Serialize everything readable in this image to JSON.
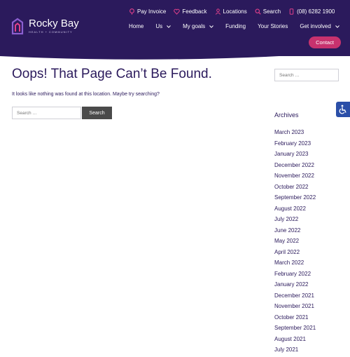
{
  "header": {
    "logo": {
      "title": "Rocky Bay",
      "subtitle": "HEALTH + COMMUNITY"
    },
    "utility": [
      {
        "label": "Pay Invoice",
        "icon": "dollar-pin-icon"
      },
      {
        "label": "Feedback",
        "icon": "heart-icon"
      },
      {
        "label": "Locations",
        "icon": "people-icon"
      },
      {
        "label": "Search",
        "icon": "search-icon"
      },
      {
        "label": "(08) 6282 1900",
        "icon": "phone-icon"
      }
    ],
    "nav": [
      {
        "label": "Home"
      },
      {
        "label": "Us"
      },
      {
        "label": "My goals"
      },
      {
        "label": "Funding"
      },
      {
        "label": "Your Stories"
      },
      {
        "label": "Get involved"
      }
    ],
    "contact_label": "Contact",
    "colors": {
      "header_bg": "#2b1a5c",
      "accent": "#c8326e"
    }
  },
  "main": {
    "title": "Oops! That Page Can’t Be Found.",
    "message": "It looks like nothing was found at this location. Maybe try searching?",
    "search_placeholder": "Search …",
    "search_button": "Search"
  },
  "sidebar": {
    "search_placeholder": "Search …",
    "archives_title": "Archives",
    "archives": [
      "March 2023",
      "February 2023",
      "January 2023",
      "December 2022",
      "November 2022",
      "October 2022",
      "September 2022",
      "August 2022",
      "July 2022",
      "June 2022",
      "May 2022",
      "April 2022",
      "March 2022",
      "February 2022",
      "January 2022",
      "December 2021",
      "November 2021",
      "October 2021",
      "September 2021",
      "August 2021",
      "July 2021"
    ]
  },
  "accessibility_icon": "wheelchair-icon"
}
